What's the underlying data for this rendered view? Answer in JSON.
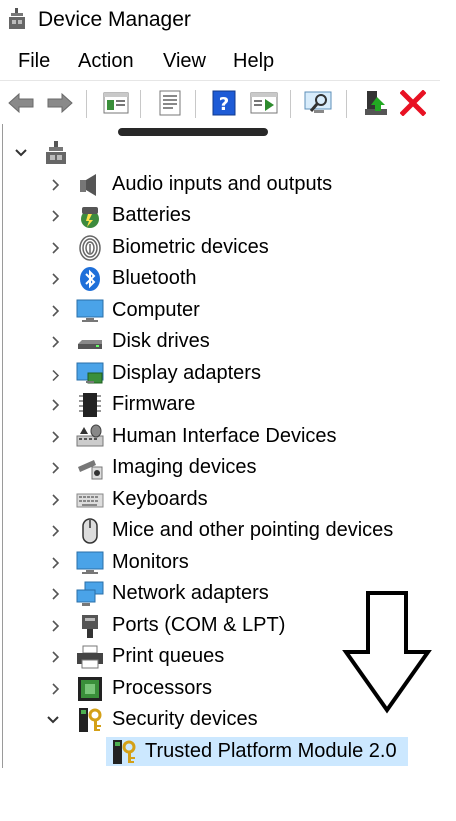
{
  "window": {
    "title": "Device Manager"
  },
  "menu": {
    "items": [
      "File",
      "Action",
      "View",
      "Help"
    ]
  },
  "toolbar": {
    "buttons": [
      "back-arrow-icon",
      "forward-arrow-icon",
      "properties-icon",
      "update-driver-icon",
      "help-icon",
      "action-pane-icon",
      "scan-hardware-icon",
      "enable-device-icon",
      "uninstall-icon"
    ]
  },
  "tree": {
    "root_label": "",
    "categories": [
      {
        "label": "Audio inputs and outputs",
        "icon": "speaker-icon",
        "expanded": false
      },
      {
        "label": "Batteries",
        "icon": "battery-icon",
        "expanded": false
      },
      {
        "label": "Biometric devices",
        "icon": "fingerprint-icon",
        "expanded": false
      },
      {
        "label": "Bluetooth",
        "icon": "bluetooth-icon",
        "expanded": false
      },
      {
        "label": "Computer",
        "icon": "monitor-icon",
        "expanded": false
      },
      {
        "label": "Disk drives",
        "icon": "disk-drive-icon",
        "expanded": false
      },
      {
        "label": "Display adapters",
        "icon": "display-adapter-icon",
        "expanded": false
      },
      {
        "label": "Firmware",
        "icon": "chip-icon",
        "expanded": false
      },
      {
        "label": "Human Interface Devices",
        "icon": "hid-icon",
        "expanded": false
      },
      {
        "label": "Imaging devices",
        "icon": "camera-icon",
        "expanded": false
      },
      {
        "label": "Keyboards",
        "icon": "keyboard-icon",
        "expanded": false
      },
      {
        "label": "Mice and other pointing devices",
        "icon": "mouse-icon",
        "expanded": false
      },
      {
        "label": "Monitors",
        "icon": "monitor-icon",
        "expanded": false
      },
      {
        "label": "Network adapters",
        "icon": "network-icon",
        "expanded": false
      },
      {
        "label": "Ports (COM & LPT)",
        "icon": "port-icon",
        "expanded": false
      },
      {
        "label": "Print queues",
        "icon": "printer-icon",
        "expanded": false
      },
      {
        "label": "Processors",
        "icon": "processor-icon",
        "expanded": false
      },
      {
        "label": "Security devices",
        "icon": "security-key-icon",
        "expanded": true
      }
    ],
    "child": {
      "label": "Trusted Platform Module 2.0",
      "icon": "security-key-icon",
      "selected": true
    }
  },
  "colors": {
    "selection": "#cce8ff",
    "uninstall": "#e81123",
    "help_blue": "#1e5bd6",
    "accent_green": "#22a822"
  }
}
